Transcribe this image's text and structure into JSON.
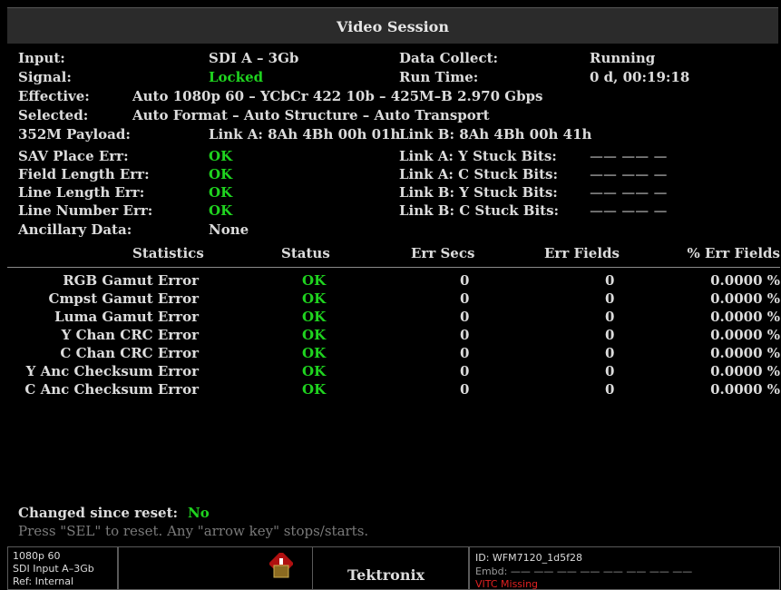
{
  "title": "Video Session",
  "info": {
    "input_label": "Input:",
    "input_value": "SDI A – 3Gb",
    "data_collect_label": "Data Collect:",
    "data_collect_value": "Running",
    "signal_label": "Signal:",
    "signal_value": "Locked",
    "run_time_label": "Run Time:",
    "run_time_value": "0 d, 00:19:18",
    "effective_label": "Effective:",
    "effective_value": "Auto 1080p 60 – YCbCr 422 10b – 425M–B 2.970 Gbps",
    "selected_label": "Selected:",
    "selected_value": "Auto Format – Auto Structure – Auto Transport",
    "payload_label": "352M Payload:",
    "payload_link_a": "Link A: 8Ah 4Bh 00h 01h",
    "payload_link_b": "Link B: 8Ah 4Bh 00h 41h"
  },
  "errors": [
    {
      "label": "SAV Place Err:",
      "value": "OK",
      "stuck_label": "Link A: Y Stuck Bits:",
      "stuck_value": "—— —— —"
    },
    {
      "label": "Field Length Err:",
      "value": "OK",
      "stuck_label": "Link A: C Stuck Bits:",
      "stuck_value": "—— —— —"
    },
    {
      "label": "Line Length Err:",
      "value": "OK",
      "stuck_label": "Link B: Y Stuck Bits:",
      "stuck_value": "—— —— —"
    },
    {
      "label": "Line Number Err:",
      "value": "OK",
      "stuck_label": "Link B: C Stuck Bits:",
      "stuck_value": "—— —— —"
    }
  ],
  "ancillary": {
    "label": "Ancillary Data:",
    "value": "None"
  },
  "table": {
    "headers": [
      "Statistics",
      "Status",
      "Err Secs",
      "Err Fields",
      "% Err Fields"
    ],
    "rows": [
      {
        "name": "RGB Gamut Error",
        "status": "OK",
        "err_secs": "0",
        "err_fields": "0",
        "pct": "0.0000 %"
      },
      {
        "name": "Cmpst Gamut Error",
        "status": "OK",
        "err_secs": "0",
        "err_fields": "0",
        "pct": "0.0000 %"
      },
      {
        "name": "Luma Gamut Error",
        "status": "OK",
        "err_secs": "0",
        "err_fields": "0",
        "pct": "0.0000 %"
      },
      {
        "name": "Y Chan CRC Error",
        "status": "OK",
        "err_secs": "0",
        "err_fields": "0",
        "pct": "0.0000 %"
      },
      {
        "name": "C Chan CRC Error",
        "status": "OK",
        "err_secs": "0",
        "err_fields": "0",
        "pct": "0.0000 %"
      },
      {
        "name": "Y Anc Checksum Error",
        "status": "OK",
        "err_secs": "0",
        "err_fields": "0",
        "pct": "0.0000 %"
      },
      {
        "name": "C Anc Checksum Error",
        "status": "OK",
        "err_secs": "0",
        "err_fields": "0",
        "pct": "0.0000 %"
      }
    ]
  },
  "footer": {
    "changed_label": "Changed since reset:",
    "changed_value": "No",
    "hint": "Press \"SEL\" to reset.  Any \"arrow key\" stops/starts."
  },
  "statusbar": {
    "format": "1080p 60",
    "input": "SDI Input A–3Gb",
    "ref": "Ref: Internal",
    "brand": "Tektronix",
    "id": "ID: WFM7120_1d5f28",
    "embd": "Embd: —— —— —— —— —— —— —— ——",
    "vitc": "VITC  Missing",
    "icons": {
      "alarm": "warning-icon"
    }
  },
  "colors": {
    "ok": "#1fd31f",
    "missing": "#e02020",
    "background": "#000000"
  }
}
